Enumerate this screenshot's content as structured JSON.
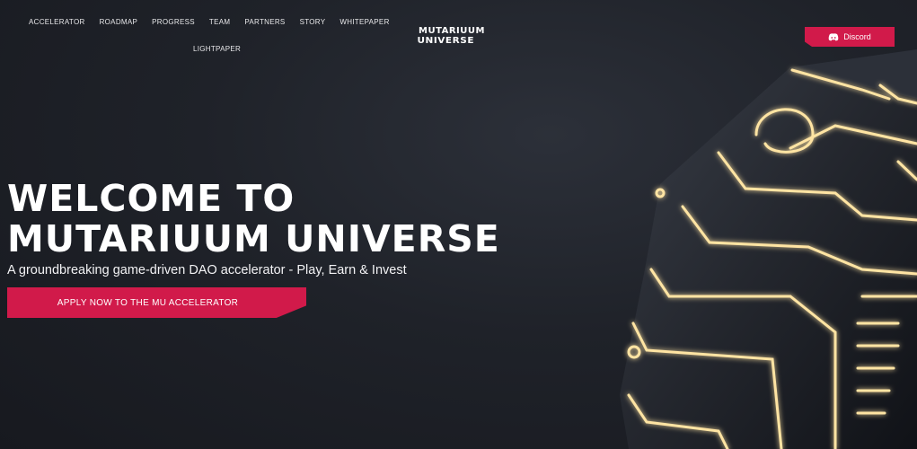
{
  "nav": {
    "items": [
      "ACCELERATOR",
      "ROADMAP",
      "PROGRESS",
      "TEAM",
      "PARTNERS",
      "STORY",
      "WHITEPAPER"
    ],
    "second_row": "LIGHTPAPER"
  },
  "logo": {
    "line1": "MUTARIUUM",
    "line2": "UNIVERSE"
  },
  "discord": {
    "label": "Discord",
    "icon": "discord-icon",
    "color": "#d11a4a"
  },
  "hero": {
    "title_line1": "WELCOME TO",
    "title_line2": "MUTARIUUM UNIVERSE",
    "subtitle": "A groundbreaking game-driven DAO accelerator - Play, Earn & Invest",
    "cta_label": "APPLY NOW TO THE MU ACCELERATOR"
  },
  "colors": {
    "accent": "#d11a4a",
    "glow": "#ffd27a",
    "background": "#1f2229"
  }
}
